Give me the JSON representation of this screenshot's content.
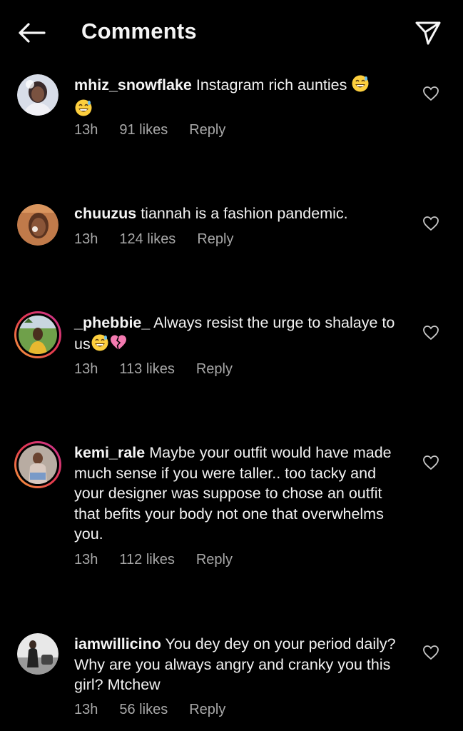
{
  "header": {
    "title": "Comments",
    "back_icon": "arrow-left-icon",
    "share_icon": "paper-plane-icon"
  },
  "colors": {
    "background": "#000000",
    "text": "#f2f2f2",
    "muted": "#a8a8a8",
    "story_ring_start": "#f7a33a",
    "story_ring_end": "#c83494"
  },
  "comments": [
    {
      "username": "mhiz_snowflake",
      "text": "Instagram rich aunties",
      "time": "13h",
      "likes": "91 likes",
      "reply": "Reply",
      "has_story_ring": false
    },
    {
      "username": "chuuzus",
      "text": "tiannah is a fashion pandemic.",
      "time": "13h",
      "likes": "124 likes",
      "reply": "Reply",
      "has_story_ring": false
    },
    {
      "username": "_phebbie_",
      "text": "Always resist the urge to shalaye to us",
      "time": "13h",
      "likes": "113 likes",
      "reply": "Reply",
      "has_story_ring": true
    },
    {
      "username": "kemi_rale",
      "text": "Maybe your outfit would have made much sense if you were taller.. too tacky and your designer was suppose to chose an outfit that befits your body not one that overwhelms you.",
      "time": "13h",
      "likes": "112 likes",
      "reply": "Reply",
      "has_story_ring": true
    },
    {
      "username": "iamwillicino",
      "text": "You dey dey on your period daily? Why are you always angry and cranky you this girl? Mtchew",
      "time": "13h",
      "likes": "56 likes",
      "reply": "Reply",
      "has_story_ring": false
    }
  ]
}
